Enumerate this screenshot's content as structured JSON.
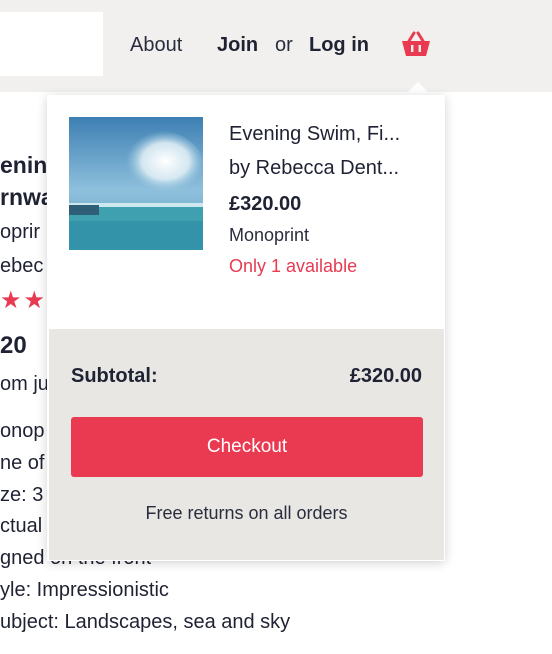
{
  "header": {
    "nav": {
      "about": "About",
      "join": "Join",
      "or": "or",
      "login": "Log in"
    },
    "basket_icon": "basket-icon",
    "accent_color": "#ea3a51"
  },
  "background_product": {
    "title_line1": "ening",
    "title_line2": "rnwa",
    "medium": "oprir",
    "artist": "ebec",
    "rating_stars": 2,
    "price": "20",
    "from_text": "om ju",
    "details": [
      "onop",
      "ne of",
      "ze: 3",
      "ctual",
      "gned on the front",
      "yle: Impressionistic",
      "ubject: Landscapes, sea and sky"
    ]
  },
  "cart": {
    "item": {
      "title": "Evening Swim, Fi...",
      "artist": "by Rebecca Dent...",
      "price": "£320.00",
      "medium": "Monoprint",
      "stock": "Only 1 available"
    },
    "subtotal_label": "Subtotal:",
    "subtotal_value": "£320.00",
    "checkout_label": "Checkout",
    "free_returns": "Free returns on all orders"
  }
}
